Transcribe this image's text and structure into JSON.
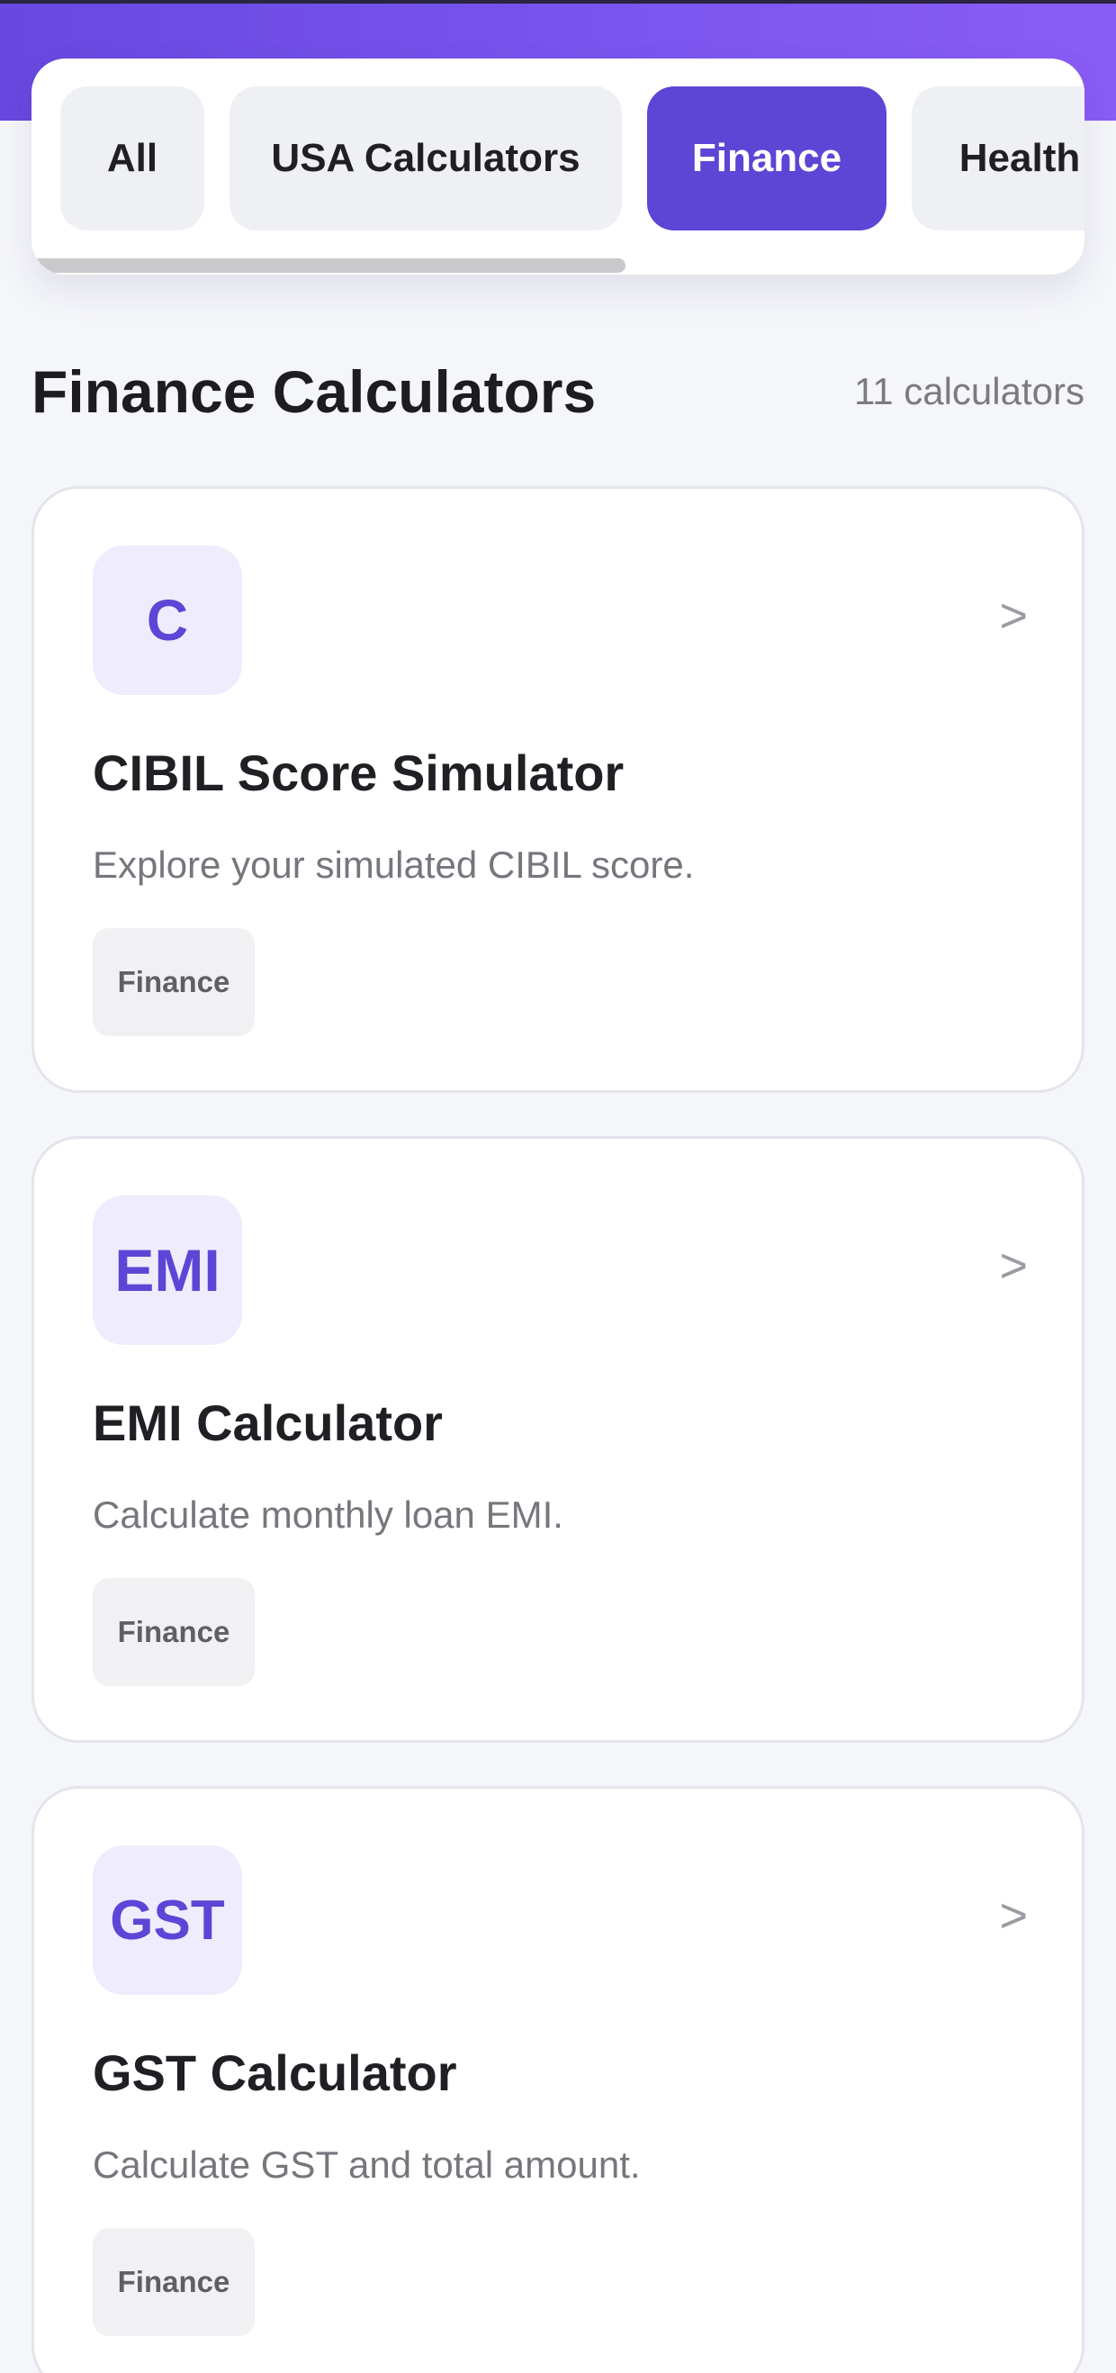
{
  "tabs": [
    {
      "label": "All",
      "active": false
    },
    {
      "label": "USA Calculators",
      "active": false
    },
    {
      "label": "Finance",
      "active": true
    },
    {
      "label": "Health",
      "active": false
    }
  ],
  "section": {
    "title": "Finance Calculators",
    "count": "11 calculators"
  },
  "cards": [
    {
      "badge": "C",
      "title": "CIBIL Score Simulator",
      "description": "Explore your simulated CIBIL score.",
      "tag": "Finance",
      "arrow": ">"
    },
    {
      "badge": "EMI",
      "title": "EMI Calculator",
      "description": "Calculate monthly loan EMI.",
      "tag": "Finance",
      "arrow": ">"
    },
    {
      "badge": "GST",
      "title": "GST Calculator",
      "description": "Calculate GST and total amount.",
      "tag": "Finance",
      "arrow": ">"
    }
  ],
  "colors": {
    "accent": "#5d45d6",
    "badge_bg": "#efecfd",
    "header_gradient_start": "#6748e0",
    "header_gradient_end": "#8a5cf6"
  }
}
